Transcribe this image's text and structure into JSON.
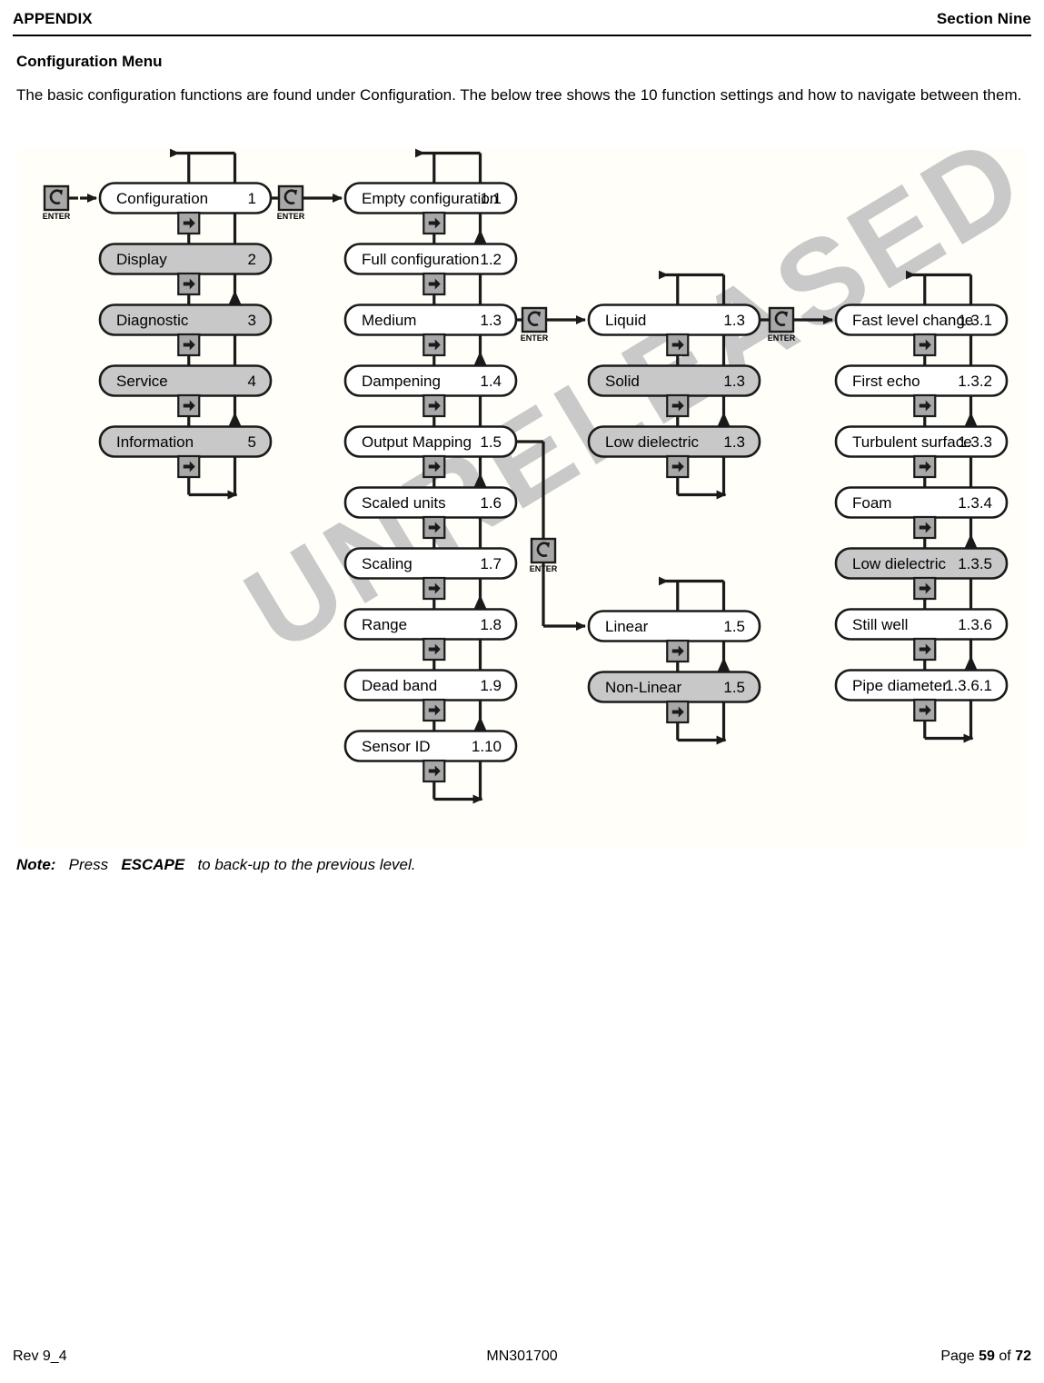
{
  "header": {
    "left": "APPENDIX",
    "right": "Section Nine"
  },
  "section": {
    "title": "Configuration Menu",
    "intro": "The basic configuration functions are found under Configuration.  The below tree shows the 10 function settings and how to navigate between them."
  },
  "note": {
    "prefix": "Note:",
    "text_before": "Press",
    "emphasis": "ESCAPE",
    "text_after": "to back-up to the previous level."
  },
  "footer": {
    "left": "Rev 9_4",
    "center": "MN301700",
    "page_label": "Page",
    "page_number": "59",
    "of_label": "of",
    "total_pages": "72"
  },
  "watermark": "UNRELEASED",
  "diagram": {
    "enter_label": "ENTER",
    "colors": {
      "box_white": "#ffffff",
      "box_gray": "#c8c8c8",
      "button_gray": "#a8a8a8",
      "line": "#1a1a1a",
      "canvas": "#fffef9"
    },
    "columns": [
      {
        "id": "column-menu-level-1",
        "items": [
          {
            "label": "Configuration",
            "index": "1",
            "shade": "white"
          },
          {
            "label": "Display",
            "index": "2",
            "shade": "gray"
          },
          {
            "label": "Diagnostic",
            "index": "3",
            "shade": "gray"
          },
          {
            "label": "Service",
            "index": "4",
            "shade": "gray"
          },
          {
            "label": "Information",
            "index": "5",
            "shade": "gray"
          }
        ]
      },
      {
        "id": "column-configuration-submenu",
        "items": [
          {
            "label": "Empty configuration",
            "index": "1.1",
            "shade": "white"
          },
          {
            "label": "Full configuration",
            "index": "1.2",
            "shade": "white"
          },
          {
            "label": "Medium",
            "index": "1.3",
            "shade": "white"
          },
          {
            "label": "Dampening",
            "index": "1.4",
            "shade": "white"
          },
          {
            "label": "Output Mapping",
            "index": "1.5",
            "shade": "white"
          },
          {
            "label": "Scaled units",
            "index": "1.6",
            "shade": "white"
          },
          {
            "label": "Scaling",
            "index": "1.7",
            "shade": "white"
          },
          {
            "label": "Range",
            "index": "1.8",
            "shade": "white"
          },
          {
            "label": "Dead band",
            "index": "1.9",
            "shade": "white"
          },
          {
            "label": "Sensor ID",
            "index": "1.10",
            "shade": "white"
          }
        ]
      },
      {
        "id": "column-medium-submenu",
        "items": [
          {
            "label": "Liquid",
            "index": "1.3",
            "shade": "white"
          },
          {
            "label": "Solid",
            "index": "1.3",
            "shade": "gray"
          },
          {
            "label": "Low dielectric",
            "index": "1.3",
            "shade": "gray"
          }
        ]
      },
      {
        "id": "column-output-mapping-submenu",
        "items": [
          {
            "label": "Linear",
            "index": "1.5",
            "shade": "white"
          },
          {
            "label": "Non-Linear",
            "index": "1.5",
            "shade": "gray"
          }
        ]
      },
      {
        "id": "column-liquid-submenu",
        "items": [
          {
            "label": "Fast level change",
            "index": "1.3.1",
            "shade": "white"
          },
          {
            "label": "First echo",
            "index": "1.3.2",
            "shade": "white"
          },
          {
            "label": "Turbulent surface",
            "index": "1.3.3",
            "shade": "white"
          },
          {
            "label": "Foam",
            "index": "1.3.4",
            "shade": "white"
          },
          {
            "label": "Low dielectric",
            "index": "1.3.5",
            "shade": "gray"
          },
          {
            "label": "Still well",
            "index": "1.3.6",
            "shade": "white"
          },
          {
            "label": "Pipe diameter",
            "index": "1.3.6.1",
            "shade": "white"
          }
        ]
      }
    ]
  }
}
